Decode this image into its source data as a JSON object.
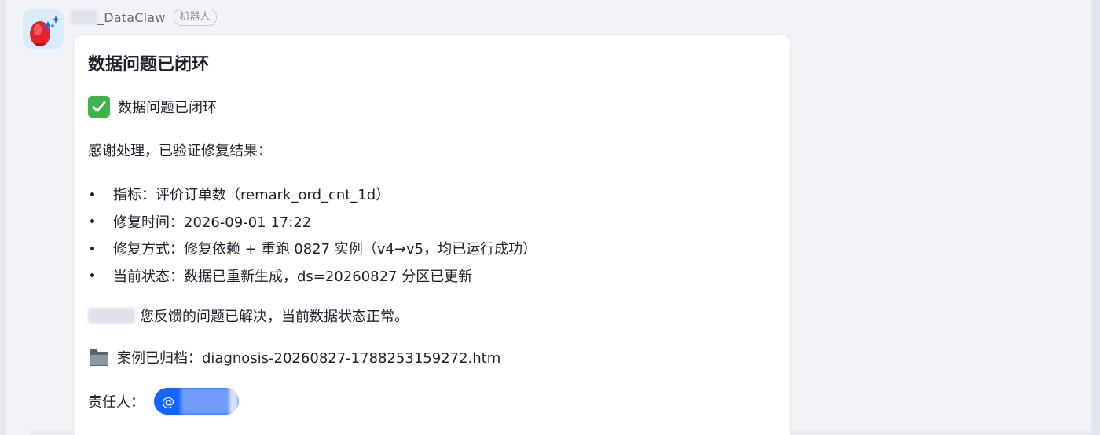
{
  "sender": {
    "name": "_DataClaw",
    "tag": "机器人"
  },
  "message": {
    "title": "数据问题已闭环",
    "status_line": "数据问题已闭环",
    "intro": "感谢处理，已验证修复结果：",
    "bullets": [
      "指标：评价订单数（remark_ord_cnt_1d）",
      "修复时间：2026-09-01 17:22",
      "修复方式：修复依赖 + 重跑 0827 实例（v4→v5，均已运行成功）",
      "当前状态：数据已重新生成，ds=20260827 分区已更新"
    ],
    "resolution": "您反馈的问题已解决，当前数据状态正常。",
    "archive": "案例已归档：diagnosis-20260827-1788253159272.htm",
    "owner_label": "责任人：",
    "mention_prefix": "@"
  },
  "icons": {
    "check": "check-mark-button-icon",
    "folder": "file-folder-icon",
    "avatar": "rocket-bot-avatar-icon"
  },
  "colors": {
    "accent": "#1664ff",
    "check_green": "#3bb54a",
    "avatar_bg": "#d9ebff",
    "avatar_red": "#e3242b"
  }
}
